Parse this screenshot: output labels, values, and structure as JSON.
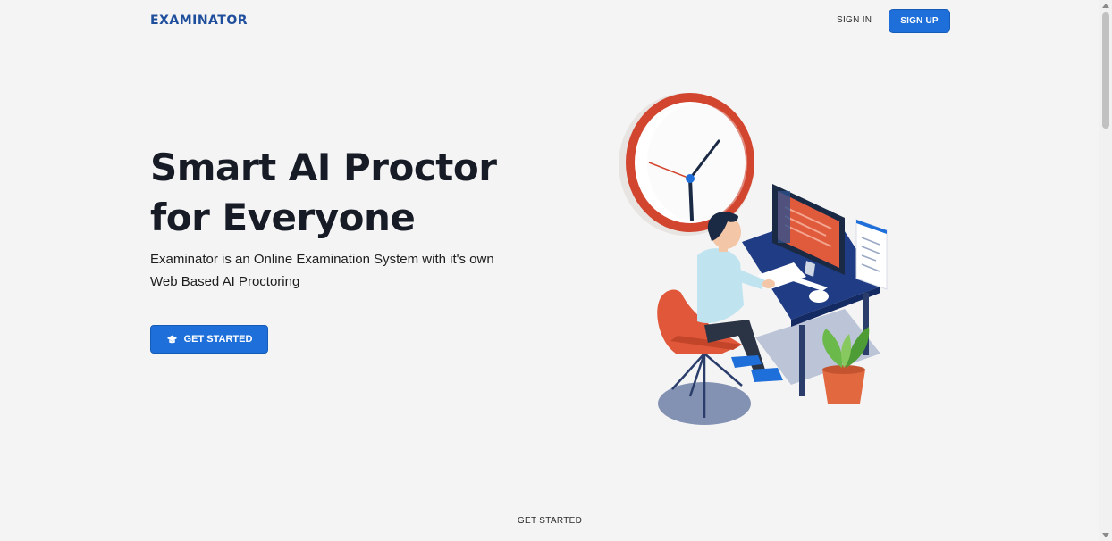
{
  "navbar": {
    "brand": "EXAMINATOR",
    "signin_label": "SIGN IN",
    "signup_label": "SIGN UP"
  },
  "hero": {
    "title_line1": "Smart AI Proctor",
    "title_line2": "for Everyone",
    "description_line1": "Examinator is an Online Examination System with it's own",
    "description_line2": "Web Based AI Proctoring",
    "cta_label": "GET STARTED",
    "cta_icon": "graduation-cap-icon",
    "illustration": "person-at-desk-with-clock-illustration"
  },
  "footer": {
    "link_label": "GET STARTED"
  },
  "colors": {
    "brand": "#1f4f9c",
    "primary": "#1e6fd9",
    "background": "#f4f4f5",
    "text": "#161b26"
  }
}
